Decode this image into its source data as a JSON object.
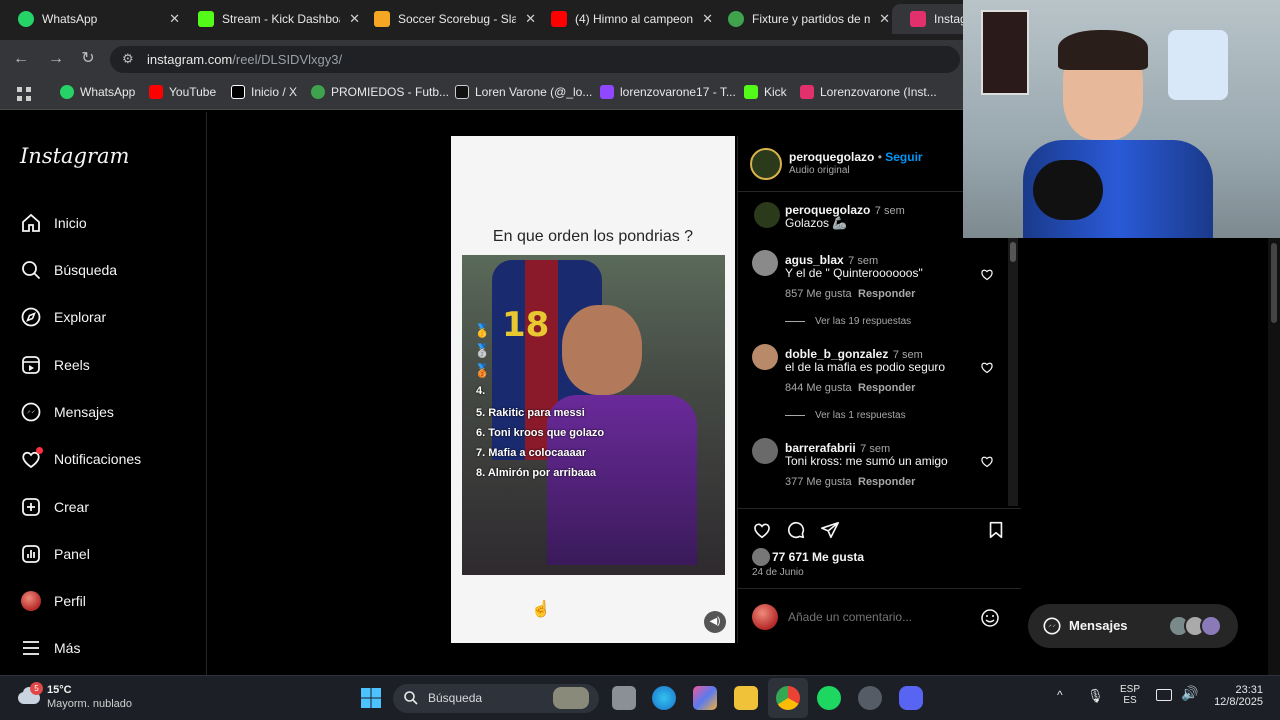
{
  "tabs": [
    {
      "label": "WhatsApp",
      "icon": "whatsapp-icon",
      "color": "#25d366"
    },
    {
      "label": "Stream - Kick Dashboard",
      "icon": "kick-icon",
      "color": "#53fc18"
    },
    {
      "label": "Soccer Scorebug - Slam",
      "icon": "scorebug-icon",
      "color": "#f5a623"
    },
    {
      "label": "(4) Himno al campeon",
      "icon": "youtube-icon",
      "color": "#ff0000"
    },
    {
      "label": "Fixture y partidos de m",
      "icon": "promiedos-icon",
      "color": "#3fa34d"
    },
    {
      "label": "Instagram",
      "icon": "instagram-icon",
      "color": "#e1306c"
    }
  ],
  "address": {
    "host": "instagram.com",
    "path": "/reel/DLSIDVlxgy3/"
  },
  "bookmarks": [
    {
      "label": "WhatsApp",
      "icon": "whatsapp-icon",
      "color": "#25d366"
    },
    {
      "label": "YouTube",
      "icon": "youtube-icon",
      "color": "#ff0000"
    },
    {
      "label": "Inicio / X",
      "icon": "x-icon",
      "color": "#ffffff"
    },
    {
      "label": "PROMIEDOS - Futb...",
      "icon": "promiedos-icon",
      "color": "#3fa34d"
    },
    {
      "label": "Loren Varone (@_lo...",
      "icon": "tiktok-icon",
      "color": "#ffffff"
    },
    {
      "label": "lorenzovarone17 - T...",
      "icon": "twitch-icon",
      "color": "#9146ff"
    },
    {
      "label": "Kick",
      "icon": "kick-icon",
      "color": "#53fc18"
    },
    {
      "label": "Lorenzovarone (Inst...",
      "icon": "instagram-icon",
      "color": "#e1306c"
    }
  ],
  "sidebar": {
    "logo": "Instagram",
    "items": [
      {
        "label": "Inicio",
        "icon": "home-icon"
      },
      {
        "label": "Búsqueda",
        "icon": "search-icon"
      },
      {
        "label": "Explorar",
        "icon": "compass-icon"
      },
      {
        "label": "Reels",
        "icon": "reels-icon"
      },
      {
        "label": "Mensajes",
        "icon": "messenger-icon"
      },
      {
        "label": "Notificaciones",
        "icon": "heart-icon"
      },
      {
        "label": "Crear",
        "icon": "plus-square-icon"
      },
      {
        "label": "Panel",
        "icon": "chart-icon"
      },
      {
        "label": "Perfil",
        "icon": "profile-avatar-icon"
      },
      {
        "label": "Más",
        "icon": "menu-icon"
      }
    ]
  },
  "reel": {
    "question": "En que orden los pondrias ?",
    "ranks": [
      "4.",
      "5. Rakitic para messi",
      "6. Toni kroos que golazo",
      "7. Mafia a colocaaaar",
      "8. Almirón por arribaaa"
    ],
    "jersey_number": "18"
  },
  "post": {
    "author": "peroquegolazo",
    "follow": "Seguir",
    "audio": "Audio original",
    "caption_user": "peroquegolazo",
    "caption_time": "7 sem",
    "caption_text": "Golazos 🦾",
    "likes": "77 671 Me gusta",
    "date": "24 de Junio",
    "comment_placeholder": "Añade un comentario..."
  },
  "comments": [
    {
      "user": "agus_blax",
      "time": "7 sem",
      "text": "Y el de \" Quinteroooooos\"",
      "likes": "857 Me gusta",
      "reply": "Responder",
      "replies": "Ver las 19 respuestas"
    },
    {
      "user": "doble_b_gonzalez",
      "time": "7 sem",
      "text": "el de la mafia es podio seguro",
      "likes": "844 Me gusta",
      "reply": "Responder",
      "replies": "Ver las 1 respuestas"
    },
    {
      "user": "barrerafabrii",
      "time": "7 sem",
      "text": "Toni kross: me sumó un amigo",
      "likes": "377 Me gusta",
      "reply": "Responder",
      "replies": ""
    }
  ],
  "messages_pill": {
    "label": "Mensajes"
  },
  "taskbar": {
    "weather_temp": "15°C",
    "weather_desc": "Mayorm. nublado",
    "weather_badge": "5",
    "search_label": "Búsqueda",
    "lang_top": "ESP",
    "lang_bottom": "ES",
    "time": "23:31",
    "date": "12/8/2025"
  },
  "colors": {
    "accent": "#0095f6",
    "bg": "#000000",
    "panel_border": "#262626"
  }
}
